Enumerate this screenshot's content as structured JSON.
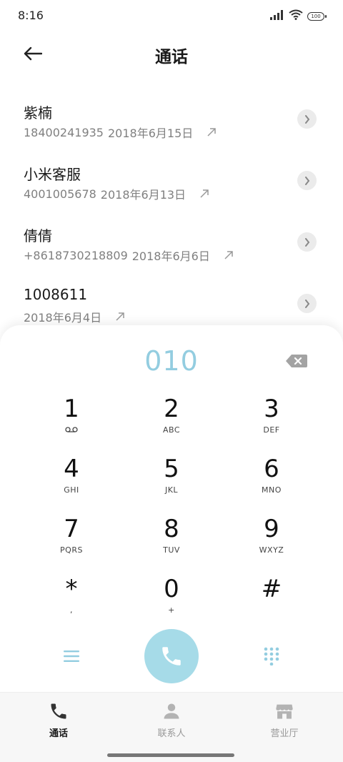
{
  "status_bar": {
    "time": "8:16",
    "battery": "100"
  },
  "header": {
    "title": "通话"
  },
  "calls": [
    {
      "name": "紫楠",
      "number": "18400241935",
      "date": "2018年6月15日"
    },
    {
      "name": "小米客服",
      "number": "4001005678",
      "date": "2018年6月13日"
    },
    {
      "name": "倩倩",
      "number": "+8618730218809",
      "date": "2018年6月6日"
    },
    {
      "name": "1008611",
      "number": "",
      "date": "2018年6月4日"
    }
  ],
  "dialpad": {
    "display": "010",
    "keys": [
      {
        "digit": "1",
        "sub": ""
      },
      {
        "digit": "2",
        "sub": "ABC"
      },
      {
        "digit": "3",
        "sub": "DEF"
      },
      {
        "digit": "4",
        "sub": "GHI"
      },
      {
        "digit": "5",
        "sub": "JKL"
      },
      {
        "digit": "6",
        "sub": "MNO"
      },
      {
        "digit": "7",
        "sub": "PQRS"
      },
      {
        "digit": "8",
        "sub": "TUV"
      },
      {
        "digit": "9",
        "sub": "WXYZ"
      },
      {
        "digit": "*",
        "sub": ","
      },
      {
        "digit": "0",
        "sub": "+"
      },
      {
        "digit": "#",
        "sub": ""
      }
    ]
  },
  "nav": {
    "calls": "通话",
    "contacts": "联系人",
    "store": "营业厅"
  },
  "colors": {
    "accent": "#93cde0",
    "call_button": "#a6dbe8",
    "secondary_text": "#808080"
  }
}
